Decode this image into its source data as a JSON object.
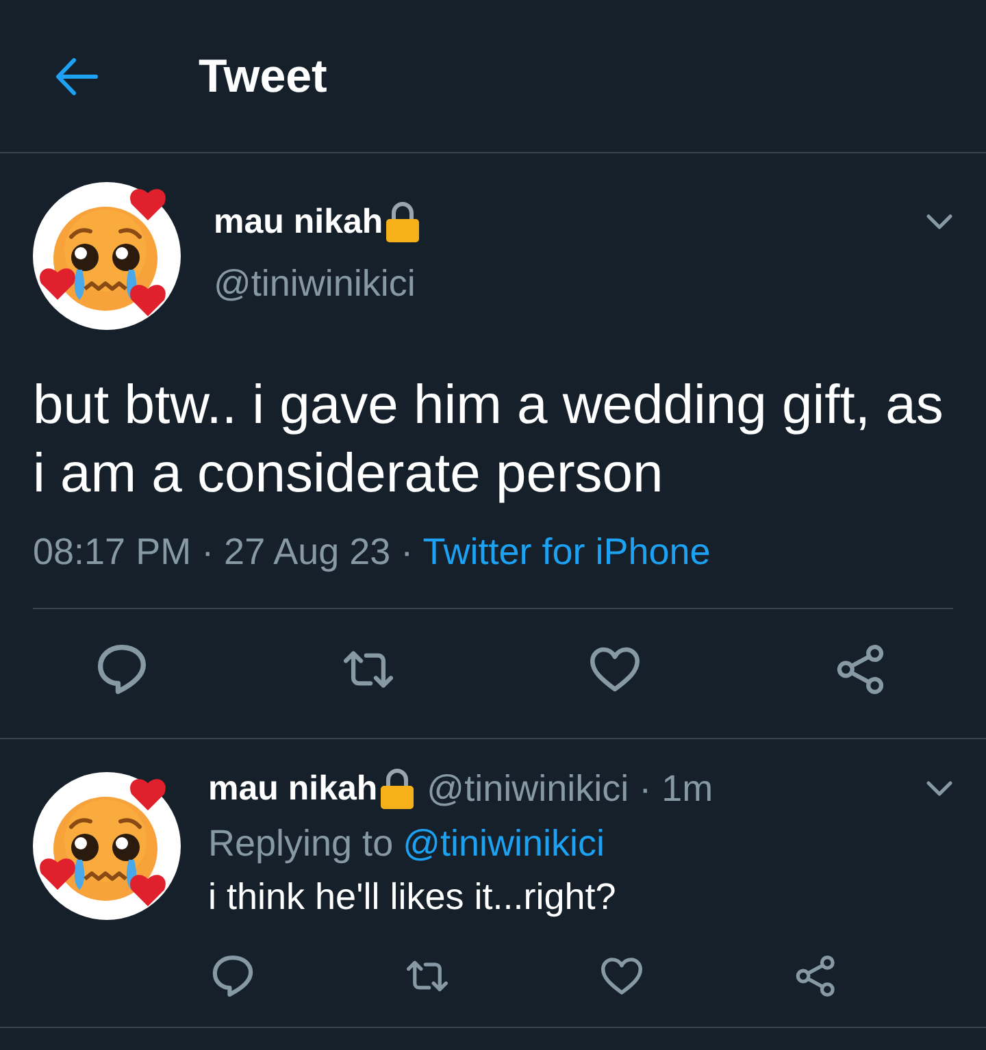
{
  "header": {
    "title": "Tweet"
  },
  "tweet": {
    "author": {
      "name": "mau nikah",
      "handle": "@tiniwinikici"
    },
    "text": "but btw.. i gave him a wedding gift, as i am a considerate person",
    "meta": [
      {
        "kind": "plain",
        "text": "08:17 PM · 27 Aug 23 ·"
      },
      {
        "kind": "link",
        "text": "Twitter for iPhone"
      }
    ]
  },
  "reply": {
    "author": {
      "name": "mau nikah",
      "handle_and_age": "@tiniwinikici · 1m"
    },
    "replying_label": "Replying to",
    "replying_handle": "@tiniwinikici",
    "text": "i think he'll likes it...right?"
  }
}
